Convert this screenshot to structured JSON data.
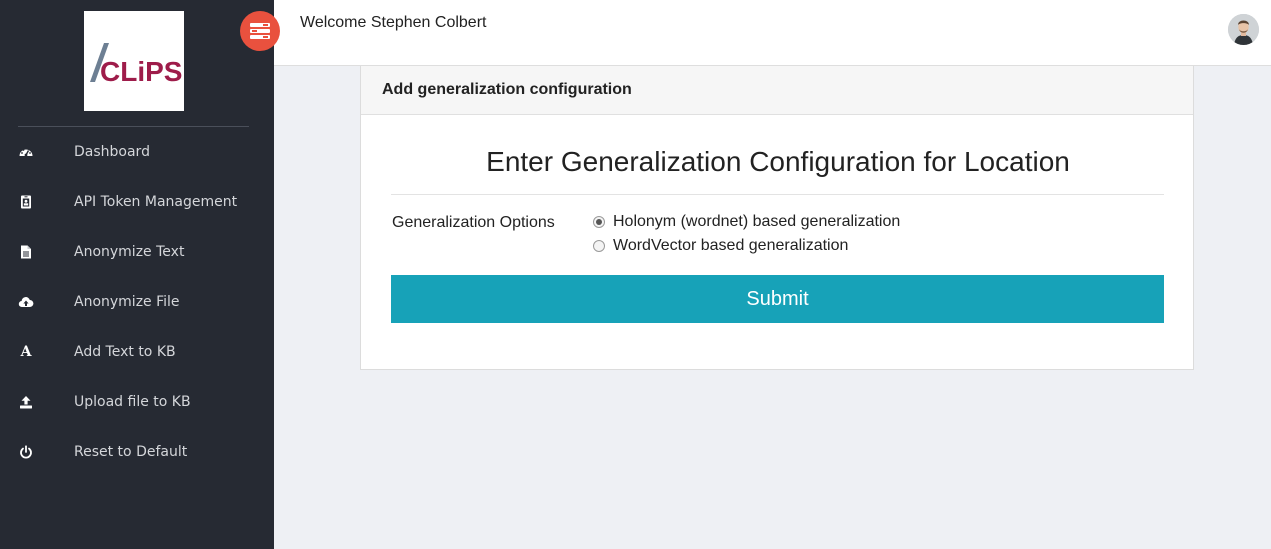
{
  "app": {
    "logo_text": "CLiPS",
    "brand_color": "#9e1c4a"
  },
  "sidebar": {
    "items": [
      {
        "label": "Dashboard",
        "icon": "dashboard-icon"
      },
      {
        "label": "API Token Management",
        "icon": "id-badge-icon"
      },
      {
        "label": "Anonymize Text",
        "icon": "file-text-icon"
      },
      {
        "label": "Anonymize File",
        "icon": "cloud-upload-icon"
      },
      {
        "label": "Add Text to KB",
        "icon": "font-a-icon",
        "glyph": "A"
      },
      {
        "label": "Upload file to KB",
        "icon": "upload-icon"
      },
      {
        "label": "Reset to Default",
        "icon": "power-icon"
      }
    ]
  },
  "topbar": {
    "welcome": "Welcome Stephen Colbert",
    "toggle_icon": "menu-toggle-icon",
    "toggle_color": "#e9513e",
    "avatar_icon": "user-avatar"
  },
  "card": {
    "header": "Add generalization configuration",
    "title": "Enter Generalization Configuration for Location",
    "options_label": "Generalization Options",
    "options": [
      {
        "label": "Holonym (wordnet) based generalization",
        "selected": true
      },
      {
        "label": "WordVector based generalization",
        "selected": false
      }
    ],
    "submit_label": "Submit",
    "submit_color": "#17a2b8"
  }
}
